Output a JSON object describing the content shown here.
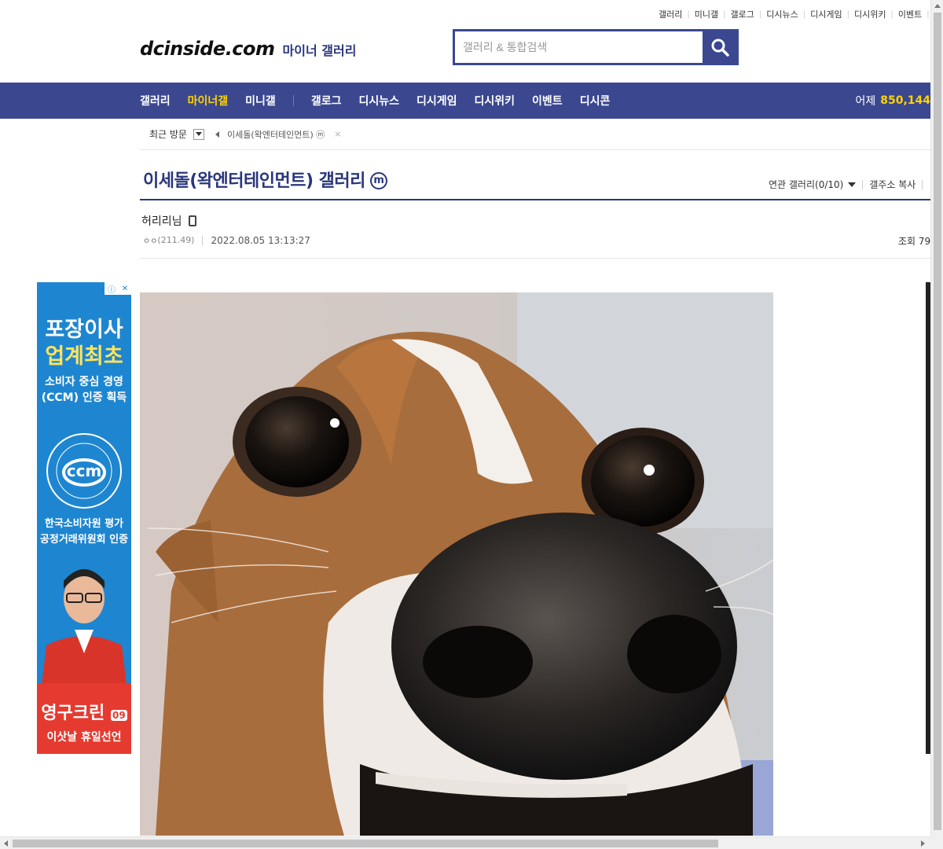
{
  "top_links": [
    "갤러리",
    "미니갤",
    "갤로그",
    "디시뉴스",
    "디시게임",
    "디시위키",
    "이벤트"
  ],
  "logo": {
    "main": "dcinside.com",
    "sub": "마이너 갤러리"
  },
  "search": {
    "placeholder": "갤러리 & 통합검색"
  },
  "nav": {
    "items": [
      "갤러리",
      "마이너갤",
      "미니갤",
      "갤로그",
      "디시뉴스",
      "디시게임",
      "디시위키",
      "이벤트",
      "디시콘"
    ],
    "active": "마이너갤",
    "yesterday_label": "어제",
    "yesterday_count": "850,144"
  },
  "recent": {
    "label": "최근 방문",
    "item": "이세돌(왁엔터테인먼트) ⓜ"
  },
  "gallery": {
    "title": "이세돌(왁엔터테인먼트) 갤러리",
    "badge": "ⓜ",
    "related": "연관 갤러리(0/10)",
    "copy_address": "갤주소 복사"
  },
  "post": {
    "author": "허리리님",
    "ip_prefix": "ㅇㅇ",
    "ip": "(211.49)",
    "datetime": "2022.08.05 13:13:27",
    "views_label": "조회 79"
  },
  "ad": {
    "line1": "포장이사",
    "line2": "업계최초",
    "line3": "소비자 중심 경영",
    "line4": "(CCM) 인증 획득",
    "ccm": "ccm",
    "line5": "한국소비자원 평가",
    "line6": "공정거래위원회 인증",
    "brand": "영구크린",
    "brand_tag": "09",
    "slogan": "이삿날 휴일선언"
  },
  "colors": {
    "brand": "#3b4890",
    "title": "#29367c",
    "active_nav": "#ffd400",
    "ad_blue": "#1e86d0",
    "ad_red": "#e53a2f"
  },
  "icons": {
    "search": "search-icon",
    "phone": "mobile-icon",
    "dropdown": "chevron-down-icon"
  }
}
